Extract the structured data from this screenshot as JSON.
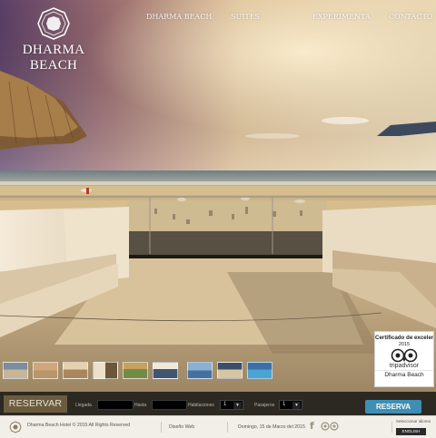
{
  "brand": {
    "name": "DHARMA BEACH"
  },
  "nav": {
    "items": [
      "DHARMA BEACH",
      "SUITES",
      "EXPERIMENTA",
      "CONTACTO"
    ]
  },
  "thumbnails": [
    "beach-1",
    "beach-2",
    "beach-3",
    "room-1",
    "beach-4",
    "pool-1",
    "beach-5",
    "bar-1",
    "pool-2"
  ],
  "badge": {
    "title": "Certificado de excelencia",
    "year": "2015",
    "provider": "tripadvisor",
    "name": "Dharma Beach"
  },
  "booking": {
    "title": "RESERVAR",
    "llegada_label": "Llegada",
    "hasta_label": "Hasta",
    "habitaciones_label": "Habitaciones",
    "habitaciones_value": "1",
    "pasajeros_label": "Pasajeros",
    "pasajeros_value": "1",
    "submit_label": "RESERVA"
  },
  "footer": {
    "copyright": "Dharma Beach Hotel © 2015 All Rights Reserved",
    "web_design": "Diseño Web",
    "date": "Domingo, 15 de Marzo del 2015",
    "language_label": "Seleccionar idioma",
    "language_button": "ENGLISH"
  },
  "colors": {
    "accent": "#3e8fb3",
    "booking_title_bg": "#6b5c40",
    "bar_bg": "#2c2923"
  }
}
